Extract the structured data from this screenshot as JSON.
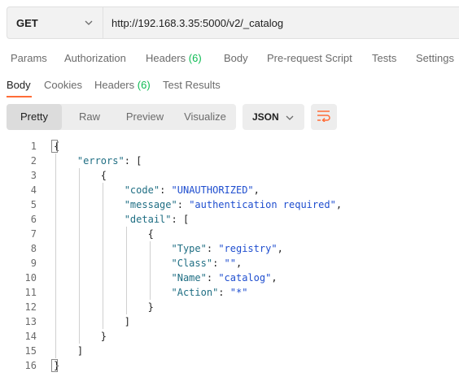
{
  "request": {
    "method": "GET",
    "url": "http://192.168.3.35:5000/v2/_catalog"
  },
  "request_tabs": {
    "params": "Params",
    "authorization": "Authorization",
    "headers": "Headers",
    "headers_count": "(6)",
    "body": "Body",
    "prerequest": "Pre-request Script",
    "tests": "Tests",
    "settings": "Settings"
  },
  "response_tabs": {
    "body": "Body",
    "cookies": "Cookies",
    "headers": "Headers",
    "headers_count": "(6)",
    "test_results": "Test Results"
  },
  "view_modes": {
    "pretty": "Pretty",
    "raw": "Raw",
    "preview": "Preview",
    "visualize": "Visualize",
    "selected": "Pretty"
  },
  "format": "JSON",
  "icons": {
    "method_dropdown": "chevron-down-icon",
    "format_dropdown": "chevron-down-icon",
    "wrap": "wrap-lines-icon"
  },
  "colors": {
    "accent": "#ff6c37",
    "count": "#0cbb52",
    "key": "#1f6e83",
    "string": "#1f4ecf"
  },
  "code_lines": [
    {
      "num": "1",
      "parts": [
        {
          "t": "{",
          "c": "p"
        }
      ]
    },
    {
      "num": "2",
      "parts": [
        {
          "t": "    ",
          "c": "p"
        },
        {
          "t": "\"errors\"",
          "c": "key"
        },
        {
          "t": ": [",
          "c": "p"
        }
      ]
    },
    {
      "num": "3",
      "parts": [
        {
          "t": "        {",
          "c": "p"
        }
      ]
    },
    {
      "num": "4",
      "parts": [
        {
          "t": "            ",
          "c": "p"
        },
        {
          "t": "\"code\"",
          "c": "key"
        },
        {
          "t": ": ",
          "c": "p"
        },
        {
          "t": "\"UNAUTHORIZED\"",
          "c": "str"
        },
        {
          "t": ",",
          "c": "p"
        }
      ]
    },
    {
      "num": "5",
      "parts": [
        {
          "t": "            ",
          "c": "p"
        },
        {
          "t": "\"message\"",
          "c": "key"
        },
        {
          "t": ": ",
          "c": "p"
        },
        {
          "t": "\"authentication required\"",
          "c": "str"
        },
        {
          "t": ",",
          "c": "p"
        }
      ]
    },
    {
      "num": "6",
      "parts": [
        {
          "t": "            ",
          "c": "p"
        },
        {
          "t": "\"detail\"",
          "c": "key"
        },
        {
          "t": ": [",
          "c": "p"
        }
      ]
    },
    {
      "num": "7",
      "parts": [
        {
          "t": "                {",
          "c": "p"
        }
      ]
    },
    {
      "num": "8",
      "parts": [
        {
          "t": "                    ",
          "c": "p"
        },
        {
          "t": "\"Type\"",
          "c": "key"
        },
        {
          "t": ": ",
          "c": "p"
        },
        {
          "t": "\"registry\"",
          "c": "str"
        },
        {
          "t": ",",
          "c": "p"
        }
      ]
    },
    {
      "num": "9",
      "parts": [
        {
          "t": "                    ",
          "c": "p"
        },
        {
          "t": "\"Class\"",
          "c": "key"
        },
        {
          "t": ": ",
          "c": "p"
        },
        {
          "t": "\"\"",
          "c": "str"
        },
        {
          "t": ",",
          "c": "p"
        }
      ]
    },
    {
      "num": "10",
      "parts": [
        {
          "t": "                    ",
          "c": "p"
        },
        {
          "t": "\"Name\"",
          "c": "key"
        },
        {
          "t": ": ",
          "c": "p"
        },
        {
          "t": "\"catalog\"",
          "c": "str"
        },
        {
          "t": ",",
          "c": "p"
        }
      ]
    },
    {
      "num": "11",
      "parts": [
        {
          "t": "                    ",
          "c": "p"
        },
        {
          "t": "\"Action\"",
          "c": "key"
        },
        {
          "t": ": ",
          "c": "p"
        },
        {
          "t": "\"*\"",
          "c": "str"
        }
      ]
    },
    {
      "num": "12",
      "parts": [
        {
          "t": "                }",
          "c": "p"
        }
      ]
    },
    {
      "num": "13",
      "parts": [
        {
          "t": "            ]",
          "c": "p"
        }
      ]
    },
    {
      "num": "14",
      "parts": [
        {
          "t": "        }",
          "c": "p"
        }
      ]
    },
    {
      "num": "15",
      "parts": [
        {
          "t": "    ]",
          "c": "p"
        }
      ]
    },
    {
      "num": "16",
      "parts": [
        {
          "t": "}",
          "c": "p"
        }
      ]
    }
  ]
}
